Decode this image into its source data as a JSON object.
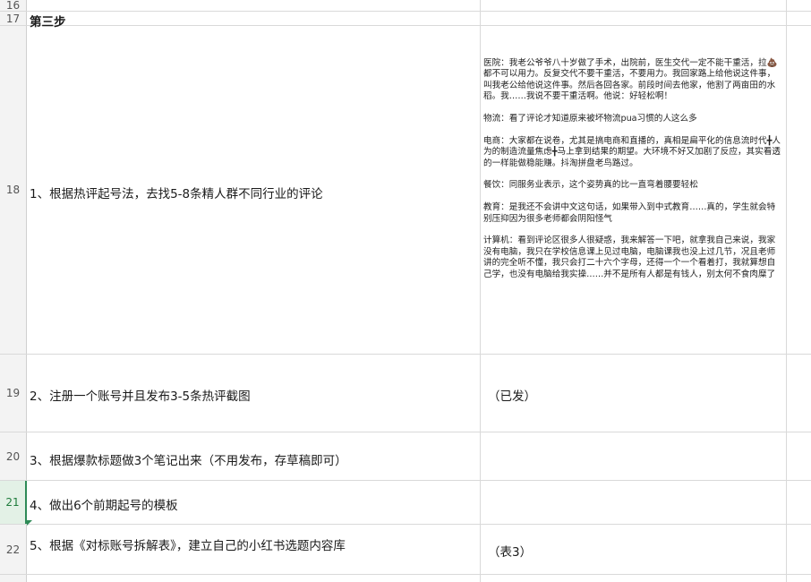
{
  "rows": [
    {
      "num": "16",
      "a": "",
      "b": ""
    },
    {
      "num": "17",
      "a": "第三步",
      "b": ""
    },
    {
      "num": "18",
      "a": "1、根据热评起号法，去找5-8条精人群不同行业的评论",
      "b_paragraphs": [
        "医院：我老公爷爷八十岁做了手术，出院前，医生交代一定不能干重活，拉💩都不可以用力。反复交代不要干重活，不要用力。我回家路上给他说这件事，叫我老公给他说这件事。然后各回各家。前段时间去他家，他割了两亩田的水稻。我……我说不要干重活啊。他说：好轻松啊！",
        "物流：看了评论才知道原来被坏物流pua习惯的人这么多",
        "电商：大家都在说卷，尤其是搞电商和直播的，真相是扁平化的信息流时代╋人为的制造流量焦虑╋马上拿到结果的期望。大环境不好又加剧了反应，其实看透的一样能做稳能赚。抖淘拼盘老鸟路过。",
        "餐饮：同服务业表示，这个姿势真的比一直弯着腰要轻松",
        "教育：是我还不会讲中文这句话，如果带入到中式教育……真的，学生就会特别压抑因为很多老师都会阴阳怪气",
        "计算机：看到评论区很多人很疑惑，我来解答一下吧，就拿我自己来说，我家没有电脑，我只在学校信息课上见过电脑，电脑课我也没上过几节，况且老师讲的完全听不懂，我只会打二十六个字母，还得一个一个看着打，我就算想自己学，也没有电脑给我实操……并不是所有人都是有钱人，别太何不食肉糜了"
      ]
    },
    {
      "num": "19",
      "a": "2、注册一个账号并且发布3-5条热评截图",
      "b": "（已发）"
    },
    {
      "num": "20",
      "a": "3、根据爆款标题做3个笔记出来（不用发布，存草稿即可）",
      "b": ""
    },
    {
      "num": "21",
      "a": "4、做出6个前期起号的模板",
      "b": ""
    },
    {
      "num": "22",
      "a": "5、根据《对标账号拆解表》，建立自己的小红书选题内容库",
      "b": "（表3）"
    }
  ]
}
